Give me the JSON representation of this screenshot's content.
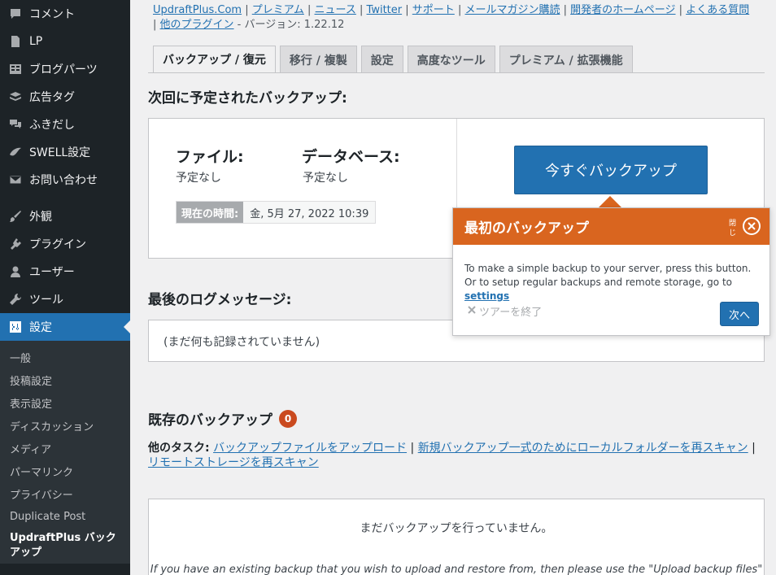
{
  "sidebar": {
    "items": [
      {
        "label": "コメント",
        "icon": "comment-icon"
      },
      {
        "label": "LP",
        "icon": "page-icon"
      },
      {
        "label": "ブログパーツ",
        "icon": "table-icon"
      },
      {
        "label": "広告タグ",
        "icon": "stack-icon"
      },
      {
        "label": "ふきだし",
        "icon": "bubbles-icon"
      },
      {
        "label": "SWELL設定",
        "icon": "swell-icon"
      },
      {
        "label": "お問い合わせ",
        "icon": "mail-icon"
      }
    ],
    "items2": [
      {
        "label": "外観",
        "icon": "brush-icon"
      },
      {
        "label": "プラグイン",
        "icon": "plugin-icon"
      },
      {
        "label": "ユーザー",
        "icon": "user-icon"
      },
      {
        "label": "ツール",
        "icon": "wrench-icon"
      },
      {
        "label": "設定",
        "icon": "settings-icon"
      }
    ],
    "submenu": [
      "一般",
      "投稿設定",
      "表示設定",
      "ディスカッション",
      "メディア",
      "パーマリンク",
      "プライバシー",
      "Duplicate Post",
      "UpdraftPlus バックアップ"
    ]
  },
  "toplinks": {
    "links": [
      "UpdraftPlus.Com",
      "プレミアム",
      "ニュース",
      "Twitter",
      "サポート",
      "メールマガジン購読",
      "開発者のホームページ",
      "よくある質問",
      "他のプラグイン"
    ],
    "sep": "|",
    "version": " - バージョン: 1.22.12"
  },
  "tabs": [
    "バックアップ / 復元",
    "移行 / 複製",
    "設定",
    "高度なツール",
    "プレミアム / 拡張機能"
  ],
  "scheduled": {
    "title": "次回に予定されたバックアップ:",
    "files_label": "ファイル:",
    "files_value": "予定なし",
    "db_label": "データベース:",
    "db_value": "予定なし",
    "time_label": "現在の時間:",
    "time_value": "金, 5月 27, 2022 10:39",
    "backup_button": "今すぐバックアップ"
  },
  "log": {
    "title": "最後のログメッセージ:",
    "text": "(まだ何も記録されていません)"
  },
  "existing": {
    "title": "既存のバックアップ",
    "count": "0",
    "tasks_label": "他のタスク:",
    "task_links": [
      "バックアップファイルをアップロード",
      "新規バックアップ一式のためにローカルフォルダーを再スキャン",
      "リモートストレージを再スキャン"
    ],
    "none_text": "まだバックアップを行っていません。",
    "upload_hint": "If you have an existing backup that you wish to upload and restore from, then please use the \"Upload backup files\" link"
  },
  "tour": {
    "title": "最初のバックアップ",
    "close_label": "閉じ",
    "body": "To make a simple backup to your server, press this button. Or to setup regular backups and remote storage, go to ",
    "body_link": "settings",
    "end_label": "ツアーを終了",
    "next_label": "次へ"
  },
  "colors": {
    "sidebar_bg": "#1d2327",
    "accent": "#2271b1",
    "tour_orange": "#d9651f",
    "badge": "#ca4a1f"
  }
}
